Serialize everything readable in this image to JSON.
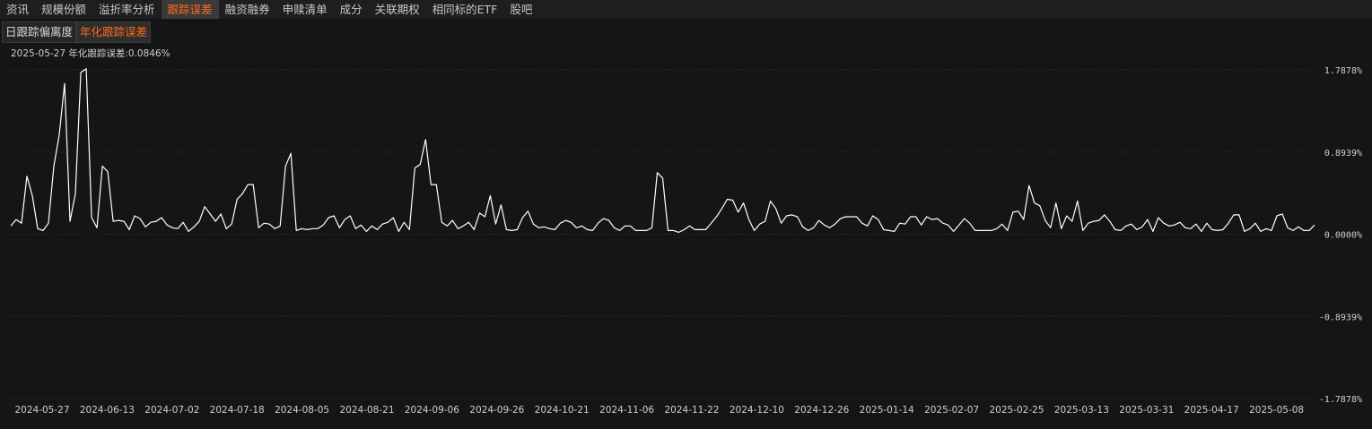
{
  "tabs": [
    {
      "label": "资讯",
      "active": false
    },
    {
      "label": "规模份额",
      "active": false
    },
    {
      "label": "溢折率分析",
      "active": false
    },
    {
      "label": "跟踪误差",
      "active": true
    },
    {
      "label": "融资融券",
      "active": false
    },
    {
      "label": "申赎清单",
      "active": false
    },
    {
      "label": "成分",
      "active": false
    },
    {
      "label": "关联期权",
      "active": false
    },
    {
      "label": "相同标的ETF",
      "active": false
    },
    {
      "label": "股吧",
      "active": false
    }
  ],
  "subtabs": [
    {
      "label": "日跟踪偏离度",
      "active": false
    },
    {
      "label": "年化跟踪误差",
      "active": true
    }
  ],
  "info": {
    "text": "2025-05-27 年化跟踪误差:0.0846%"
  },
  "colors": {
    "background": "#151515",
    "line": "#ffffff",
    "active_tab_text": "#ff6a1a",
    "grid": "#3c3c3c"
  },
  "chart_data": {
    "type": "line",
    "title": "",
    "xlabel": "",
    "ylabel": "",
    "ylim": [
      -1.7878,
      1.7878
    ],
    "yticks": [
      "1.7878%",
      "0.8939%",
      "0.0000%",
      "-0.8939%",
      "-1.7878%"
    ],
    "ytick_values": [
      1.7878,
      0.8939,
      0,
      -0.8939,
      -1.7878
    ],
    "grid": true,
    "xtick_labels": [
      "2024-05-27",
      "2024-06-13",
      "2024-07-02",
      "2024-07-18",
      "2024-08-05",
      "2024-08-21",
      "2024-09-06",
      "2024-09-26",
      "2024-10-21",
      "2024-11-06",
      "2024-11-22",
      "2024-12-10",
      "2024-12-26",
      "2025-01-14",
      "2025-02-07",
      "2025-02-25",
      "2025-03-13",
      "2025-03-31",
      "2025-04-17",
      "2025-05-08"
    ],
    "series": [
      {
        "values": [
          0.09,
          0.16,
          0.12,
          0.63,
          0.42,
          0.06,
          0.04,
          0.12,
          0.74,
          1.08,
          1.64,
          0.14,
          0.44,
          1.76,
          1.8,
          0.18,
          0.07,
          0.74,
          0.68,
          0.14,
          0.15,
          0.14,
          0.05,
          0.2,
          0.17,
          0.08,
          0.13,
          0.14,
          0.18,
          0.1,
          0.07,
          0.06,
          0.13,
          0.03,
          0.08,
          0.14,
          0.3,
          0.22,
          0.14,
          0.22,
          0.06,
          0.11,
          0.38,
          0.44,
          0.54,
          0.54,
          0.07,
          0.12,
          0.11,
          0.06,
          0.09,
          0.74,
          0.88,
          0.04,
          0.06,
          0.05,
          0.06,
          0.06,
          0.1,
          0.18,
          0.2,
          0.07,
          0.16,
          0.2,
          0.06,
          0.1,
          0.03,
          0.09,
          0.05,
          0.11,
          0.13,
          0.18,
          0.03,
          0.13,
          0.05,
          0.72,
          0.76,
          1.03,
          0.54,
          0.54,
          0.13,
          0.09,
          0.15,
          0.06,
          0.09,
          0.13,
          0.05,
          0.23,
          0.19,
          0.42,
          0.11,
          0.32,
          0.05,
          0.04,
          0.05,
          0.18,
          0.25,
          0.11,
          0.07,
          0.08,
          0.06,
          0.05,
          0.12,
          0.15,
          0.13,
          0.07,
          0.09,
          0.05,
          0.04,
          0.12,
          0.17,
          0.15,
          0.07,
          0.04,
          0.09,
          0.09,
          0.04,
          0.04,
          0.04,
          0.07,
          0.67,
          0.61,
          0.04,
          0.04,
          0.02,
          0.05,
          0.09,
          0.05,
          0.05,
          0.05,
          0.12,
          0.19,
          0.28,
          0.38,
          0.37,
          0.24,
          0.34,
          0.16,
          0.04,
          0.11,
          0.14,
          0.36,
          0.28,
          0.12,
          0.2,
          0.21,
          0.19,
          0.08,
          0.04,
          0.07,
          0.15,
          0.1,
          0.07,
          0.11,
          0.17,
          0.19,
          0.19,
          0.19,
          0.12,
          0.09,
          0.2,
          0.16,
          0.05,
          0.04,
          0.03,
          0.12,
          0.11,
          0.19,
          0.19,
          0.1,
          0.19,
          0.16,
          0.17,
          0.12,
          0.1,
          0.03,
          0.1,
          0.17,
          0.12,
          0.04,
          0.04,
          0.04,
          0.04,
          0.06,
          0.11,
          0.04,
          0.24,
          0.25,
          0.16,
          0.53,
          0.34,
          0.31,
          0.15,
          0.07,
          0.34,
          0.06,
          0.2,
          0.14,
          0.36,
          0.04,
          0.12,
          0.14,
          0.15,
          0.21,
          0.14,
          0.05,
          0.04,
          0.09,
          0.11,
          0.05,
          0.08,
          0.16,
          0.03,
          0.18,
          0.12,
          0.09,
          0.1,
          0.13,
          0.07,
          0.06,
          0.11,
          0.03,
          0.12,
          0.05,
          0.04,
          0.05,
          0.12,
          0.21,
          0.21,
          0.03,
          0.06,
          0.12,
          0.03,
          0.06,
          0.04,
          0.2,
          0.22,
          0.07,
          0.04,
          0.08,
          0.04,
          0.04,
          0.1
        ]
      }
    ]
  }
}
